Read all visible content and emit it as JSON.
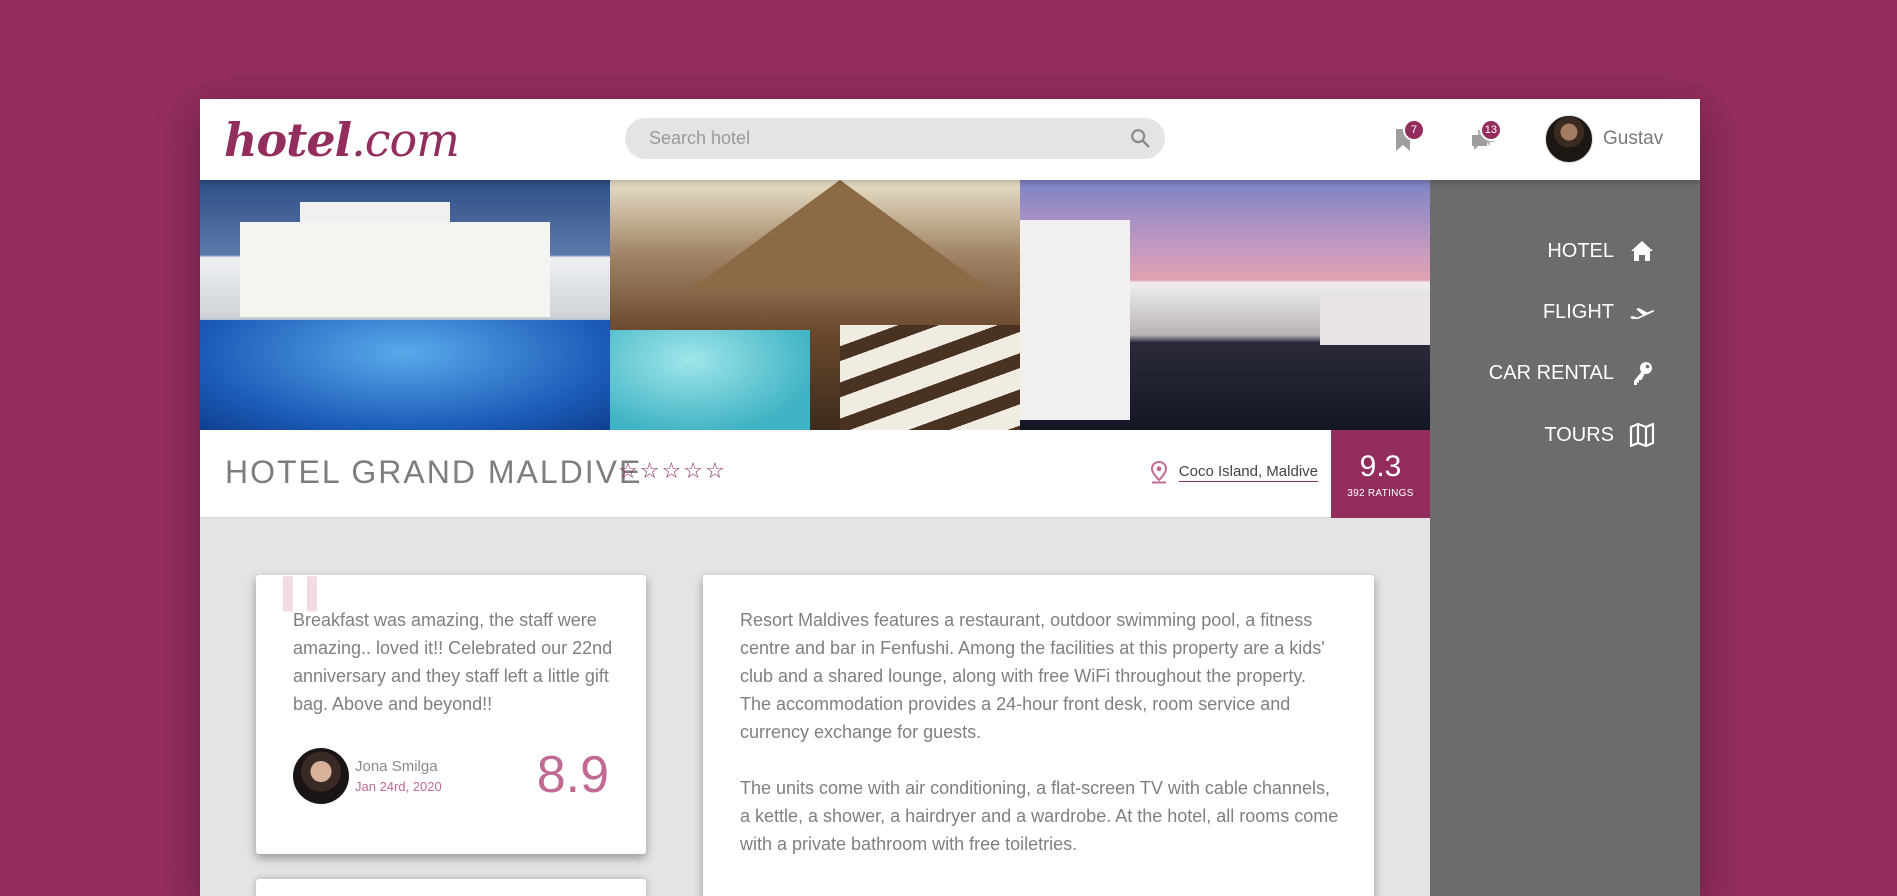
{
  "header": {
    "logo_main": "hotel",
    "logo_suffix": ".com",
    "search_placeholder": "Search hotel",
    "bookmarks_badge": "7",
    "messages_badge": "13",
    "user_name": "Gustav"
  },
  "hotel": {
    "name": "HOTEL GRAND MALDIVE",
    "stars": [
      "☆",
      "☆",
      "☆",
      "☆",
      "☆"
    ],
    "location": "Coco Island, Maldive",
    "rating": "9.3",
    "ratings_count": "392 RATINGS"
  },
  "nav": {
    "items": [
      {
        "label": "HOTEL",
        "icon": "home-icon"
      },
      {
        "label": "FLIGHT",
        "icon": "plane-icon"
      },
      {
        "label": "CAR RENTAL",
        "icon": "key-icon"
      },
      {
        "label": "TOURS",
        "icon": "map-icon"
      }
    ]
  },
  "review": {
    "text": "Breakfast was amazing, the staff were amazing.. loved it!! Celebrated our 22nd anniversary and they staff left a little gift bag. Above and beyond!!",
    "author": "Jona Smilga",
    "date": "Jan 24rd, 2020",
    "score": "8.9"
  },
  "description": {
    "p1": "Resort Maldives features a restaurant, outdoor swimming pool, a fitness centre and bar in Fenfushi. Among the facilities at this property are a kids' club and a shared lounge, along with free WiFi throughout the property. The accommodation provides a 24-hour front desk, room service and currency exchange for guests.",
    "p2": "The units come with air conditioning, a flat-screen TV with cable channels, a kettle, a shower, a hairdryer and a wardrobe. At the hotel, all rooms come with a private bathroom with free toiletries."
  },
  "colors": {
    "brand": "#932d5e",
    "sidebar": "#6c6c6c",
    "background": "#e4e4e4"
  }
}
